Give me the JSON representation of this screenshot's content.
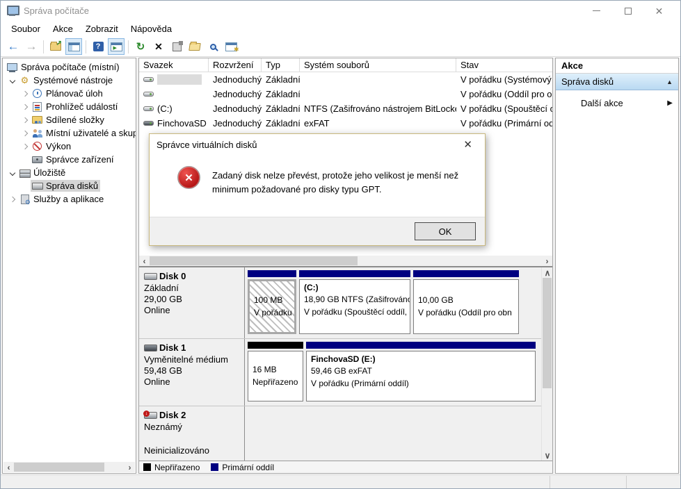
{
  "window": {
    "title": "Správa počítače"
  },
  "menu": {
    "items": [
      "Soubor",
      "Akce",
      "Zobrazit",
      "Nápověda"
    ]
  },
  "toolbar": {
    "icons": [
      "back",
      "forward",
      "up-one-level",
      "show-console-tree",
      "help",
      "show-action-pane",
      "refresh",
      "delete",
      "properties",
      "open-folder",
      "search",
      "console-options"
    ]
  },
  "tree": {
    "items": [
      {
        "label": "Správa počítače (místní)"
      },
      {
        "label": "Systémové nástroje"
      },
      {
        "label": "Plánovač úloh"
      },
      {
        "label": "Prohlížeč událostí"
      },
      {
        "label": "Sdílené složky"
      },
      {
        "label": "Místní uživatelé a skupi"
      },
      {
        "label": "Výkon"
      },
      {
        "label": "Správce zařízení"
      },
      {
        "label": "Úložiště"
      },
      {
        "label": "Správa disků"
      },
      {
        "label": "Služby a aplikace"
      }
    ]
  },
  "volumes": {
    "columns": [
      "Svazek",
      "Rozvržení",
      "Typ",
      "Systém souborů",
      "Stav"
    ],
    "rows": [
      {
        "name": "",
        "layout": "Jednoduchý",
        "type": "Základní",
        "fs": "",
        "status": "V pořádku (Systémový o"
      },
      {
        "name": "",
        "layout": "Jednoduchý",
        "type": "Základní",
        "fs": "",
        "status": "V pořádku (Oddíl pro ob"
      },
      {
        "name": "(C:)",
        "layout": "Jednoduchý",
        "type": "Základní",
        "fs": "NTFS (Zašifrováno nástrojem BitLocker)",
        "status": "V pořádku (Spouštěcí od"
      },
      {
        "name": "FinchovaSD (E:)",
        "layout": "Jednoduchý",
        "type": "Základní",
        "fs": "exFAT",
        "status": "V pořádku (Primární odd"
      }
    ]
  },
  "dialog": {
    "title": "Správce virtuálních disků",
    "message": "Zadaný disk nelze převést, protože jeho velikost je menší než minimum požadované pro disky typu GPT.",
    "ok_label": "OK"
  },
  "disks": [
    {
      "name": "Disk 0",
      "kind": "Základní",
      "size": "29,00 GB",
      "status": "Online",
      "partitions": [
        {
          "title": "",
          "line1": "100 MB",
          "line2": "V pořádku ("
        },
        {
          "title": "(C:)",
          "line1": "18,90 GB NTFS (Zašifrováno",
          "line2": "V pořádku (Spouštěcí oddíl,"
        },
        {
          "title": "",
          "line1": "10,00 GB",
          "line2": "V pořádku (Oddíl pro obn"
        }
      ]
    },
    {
      "name": "Disk 1",
      "kind": "Vyměnitelné médium",
      "size": "59,48 GB",
      "status": "Online",
      "partitions": [
        {
          "title": "",
          "line1": "16 MB",
          "line2": "Nepřiřazeno"
        },
        {
          "title": "FinchovaSD  (E:)",
          "line1": "59,46 GB exFAT",
          "line2": "V pořádku (Primární oddíl)"
        }
      ]
    },
    {
      "name": "Disk 2",
      "kind": "Neznámý",
      "size": "",
      "status": "Neinicializováno"
    }
  ],
  "legend": {
    "items": [
      {
        "label": "Nepřiřazeno",
        "color": "#000000"
      },
      {
        "label": "Primární oddíl",
        "color": "#000080"
      }
    ]
  },
  "actions": {
    "header": "Akce",
    "group_label": "Správa disků",
    "more_label": "Další akce"
  },
  "colors": {
    "partition_primary": "#000080",
    "partition_unallocated": "#000000",
    "toolbar_toggle_bg": "#dcebf8",
    "action_bar_bottom": "#b9d9f2"
  }
}
